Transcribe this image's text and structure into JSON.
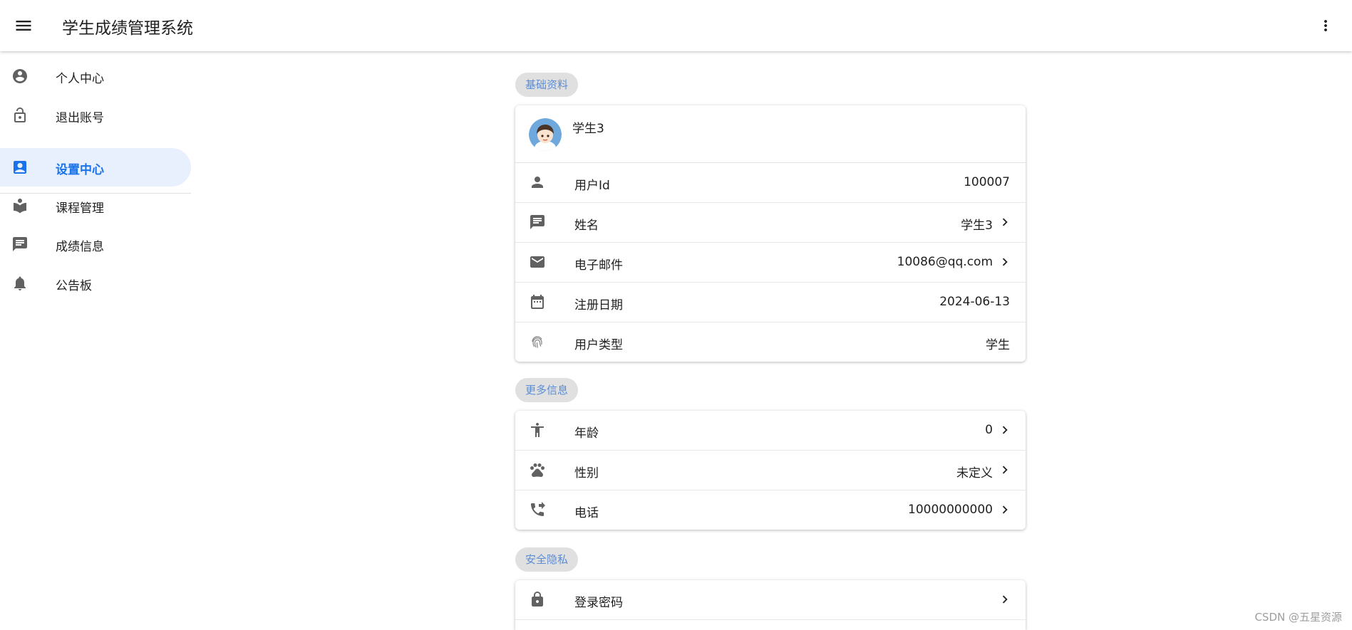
{
  "app": {
    "title": "学生成绩管理系统"
  },
  "sidebar": {
    "items": [
      {
        "label": "个人中心",
        "icon": "account-circle-icon"
      },
      {
        "label": "退出账号",
        "icon": "lock-open-icon"
      },
      {
        "label": "设置中心",
        "icon": "contact-card-icon",
        "active": true
      },
      {
        "label": "课程管理",
        "icon": "reading-book-icon"
      },
      {
        "label": "成绩信息",
        "icon": "message-icon"
      },
      {
        "label": "公告板",
        "icon": "bell-icon"
      }
    ]
  },
  "sections": {
    "basic": {
      "title": "基础资料",
      "profile_name": "学生3",
      "rows": [
        {
          "label": "用户Id",
          "value": "100007",
          "icon": "person-icon"
        },
        {
          "label": "姓名",
          "value": "学生3",
          "icon": "comment-icon"
        },
        {
          "label": "电子邮件",
          "value": "10086@qq.com",
          "icon": "mail-icon"
        },
        {
          "label": "注册日期",
          "value": "2024-06-13",
          "icon": "calendar-icon"
        },
        {
          "label": "用户类型",
          "value": "学生",
          "icon": "fingerprint-icon"
        }
      ]
    },
    "more": {
      "title": "更多信息",
      "rows": [
        {
          "label": "年龄",
          "value": "0",
          "icon": "accessibility-icon"
        },
        {
          "label": "性别",
          "value": "未定义",
          "icon": "paw-icon"
        },
        {
          "label": "电话",
          "value": "10000000000",
          "icon": "phone-forwarded-icon"
        }
      ]
    },
    "security": {
      "title": "安全隐私",
      "rows": [
        {
          "label": "登录密码",
          "value": "",
          "icon": "lock-icon"
        }
      ]
    }
  },
  "watermark": "CSDN @五星资源",
  "colors": {
    "accent": "#1a73e8",
    "active_bg": "#e8f0fe",
    "chip_bg": "#e0e0e0",
    "chip_text": "#5b8cd6"
  }
}
